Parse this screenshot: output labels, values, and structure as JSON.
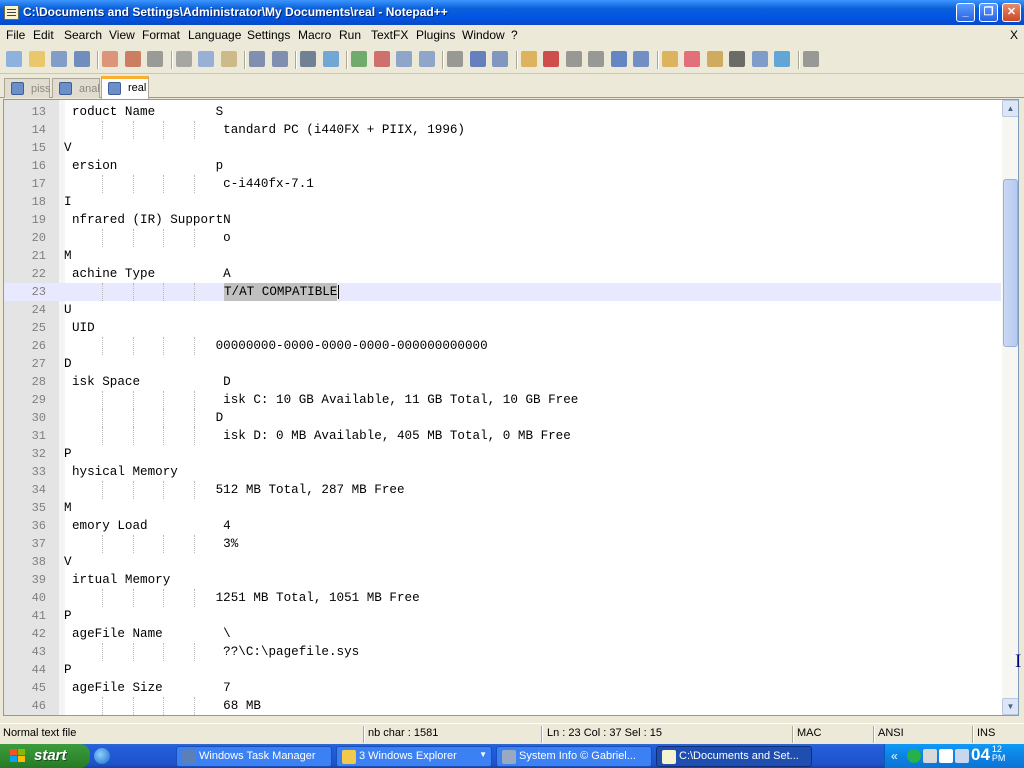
{
  "window": {
    "title": "C:\\Documents and Settings\\Administrator\\My Documents\\real - Notepad++",
    "controls": [
      "_",
      "❐",
      "✕"
    ]
  },
  "menu": [
    "File",
    "Edit",
    "Search",
    "View",
    "Format",
    "Language",
    "Settings",
    "Macro",
    "Run",
    "TextFX",
    "Plugins",
    "Window",
    "?"
  ],
  "menu_close": "X",
  "toolbar_icons": [
    "new-icon",
    "open-icon",
    "save-icon",
    "save-all-icon",
    "close-icon",
    "close-all-icon",
    "print-icon",
    "cut-icon",
    "copy-icon",
    "paste-icon",
    "undo-icon",
    "redo-icon",
    "find-icon",
    "replace-icon",
    "zoom-in-icon",
    "zoom-out-icon",
    "sync-v-icon",
    "sync-h-icon",
    "wrap-icon",
    "show-all-icon",
    "indent-guide-icon",
    "user-lang-icon",
    "record-icon",
    "stop-icon",
    "play-icon",
    "run-multi-icon",
    "save-macro-icon",
    "folder-icon",
    "heart-icon",
    "plugin-icon",
    "hex-icon",
    "console-icon",
    "spellcheck-icon",
    "print-preview-icon"
  ],
  "tabs": [
    {
      "label": "piss",
      "active": false
    },
    {
      "label": "anal",
      "active": false
    },
    {
      "label": "real",
      "active": true
    }
  ],
  "editor": {
    "current_line": 23,
    "lines": [
      {
        "num": "13",
        "text": "roduct Name        S"
      },
      {
        "num": "14",
        "text": "                    tandard PC (i440FX + PIIX, 1996)"
      },
      {
        "num": "15",
        "text": "V"
      },
      {
        "num": "16",
        "text": "ersion             p"
      },
      {
        "num": "17",
        "text": "                    c-i440fx-7.1"
      },
      {
        "num": "18",
        "text": "I"
      },
      {
        "num": "19",
        "text": "nfrared (IR) SupportN"
      },
      {
        "num": "20",
        "text": "                    o"
      },
      {
        "num": "21",
        "text": "M"
      },
      {
        "num": "22",
        "text": "achine Type         A"
      },
      {
        "num": "23",
        "text": "T/AT COMPATIBLE"
      },
      {
        "num": "24",
        "text": "U"
      },
      {
        "num": "25",
        "text": "UID"
      },
      {
        "num": "26",
        "text": "                   00000000-0000-0000-0000-000000000000"
      },
      {
        "num": "27",
        "text": "D"
      },
      {
        "num": "28",
        "text": "isk Space           D"
      },
      {
        "num": "29",
        "text": "                    isk C: 10 GB Available, 11 GB Total, 10 GB Free"
      },
      {
        "num": "30",
        "text": "                   D"
      },
      {
        "num": "31",
        "text": "                    isk D: 0 MB Available, 405 MB Total, 0 MB Free"
      },
      {
        "num": "32",
        "text": "P"
      },
      {
        "num": "33",
        "text": "hysical Memory"
      },
      {
        "num": "34",
        "text": "                   512 MB Total, 287 MB Free"
      },
      {
        "num": "35",
        "text": "M"
      },
      {
        "num": "36",
        "text": "emory Load          4"
      },
      {
        "num": "37",
        "text": "                    3%"
      },
      {
        "num": "38",
        "text": "V"
      },
      {
        "num": "39",
        "text": "irtual Memory"
      },
      {
        "num": "40",
        "text": "                   1251 MB Total, 1051 MB Free"
      },
      {
        "num": "41",
        "text": "P"
      },
      {
        "num": "42",
        "text": "ageFile Name        \\"
      },
      {
        "num": "43",
        "text": "                    ??\\C:\\pagefile.sys"
      },
      {
        "num": "44",
        "text": "P"
      },
      {
        "num": "45",
        "text": "ageFile Size        7"
      },
      {
        "num": "46",
        "text": "                    68 MB"
      }
    ]
  },
  "status": {
    "type": "Normal text file",
    "chars": "nb char : 1581",
    "pos": "Ln : 23    Col : 37    Sel : 15",
    "eol": "MAC",
    "enc": "ANSI",
    "mode": "INS"
  },
  "taskbar": {
    "start": "start",
    "tasks": [
      {
        "label": "Windows Task Manager",
        "active": false
      },
      {
        "label": "3 Windows Explorer",
        "active": false
      },
      {
        "label": "System Info  © Gabriel...",
        "active": false
      },
      {
        "label": "C:\\Documents and Set...",
        "active": true
      }
    ],
    "clock_hour": "04",
    "clock_min": "12",
    "clock_ampm": "PM"
  }
}
